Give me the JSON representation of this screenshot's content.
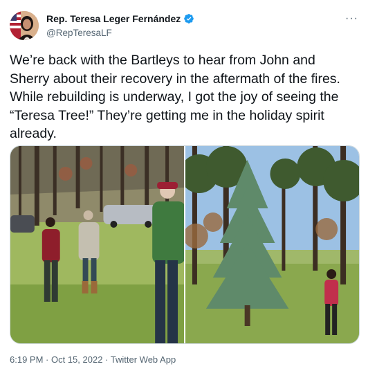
{
  "author": {
    "display_name": "Rep. Teresa Leger Fernández",
    "handle": "@RepTeresaLF",
    "verified_icon": "verified-badge-icon",
    "avatar_icon": "avatar-with-flag"
  },
  "menu": {
    "more_label": "···"
  },
  "tweet": {
    "text": "We’re back with the Bartleys to hear from John and Sherry about their recovery in the aftermath of the fires. While rebuilding is underway, I got the joy of seeing the “Teresa Tree!” They’re getting me in the holiday spirit already."
  },
  "media": {
    "photos": [
      {
        "subject": "three people standing in a burned forest meadow"
      },
      {
        "subject": "woman next to a young spruce tree in a forest"
      }
    ]
  },
  "meta": {
    "time": "6:19 PM",
    "separator": " · ",
    "date": "Oct 15, 2022",
    "source": "Twitter Web App"
  },
  "colors": {
    "text": "#0f1419",
    "secondary": "#536471",
    "verified": "#1d9bf0",
    "border": "#cfd9de"
  }
}
